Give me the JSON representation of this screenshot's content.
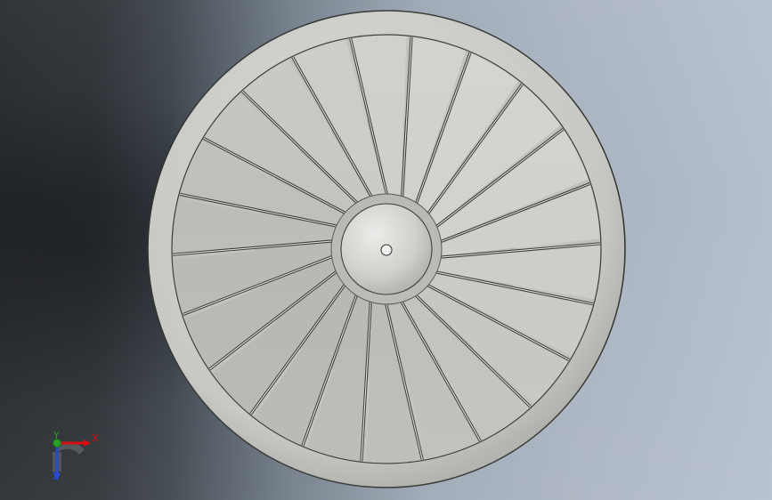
{
  "view": {
    "background_colors": [
      "#26292c",
      "#707c88",
      "#b4bfcc"
    ],
    "part_color": "#c9cac5"
  },
  "fan": {
    "blade_count": 22
  },
  "triad": {
    "x_label": "X",
    "y_label": "Y",
    "z_label": "Z",
    "x_color": "#d40000",
    "y_color": "#1a9b1a",
    "z_color": "#1a3fd0"
  }
}
